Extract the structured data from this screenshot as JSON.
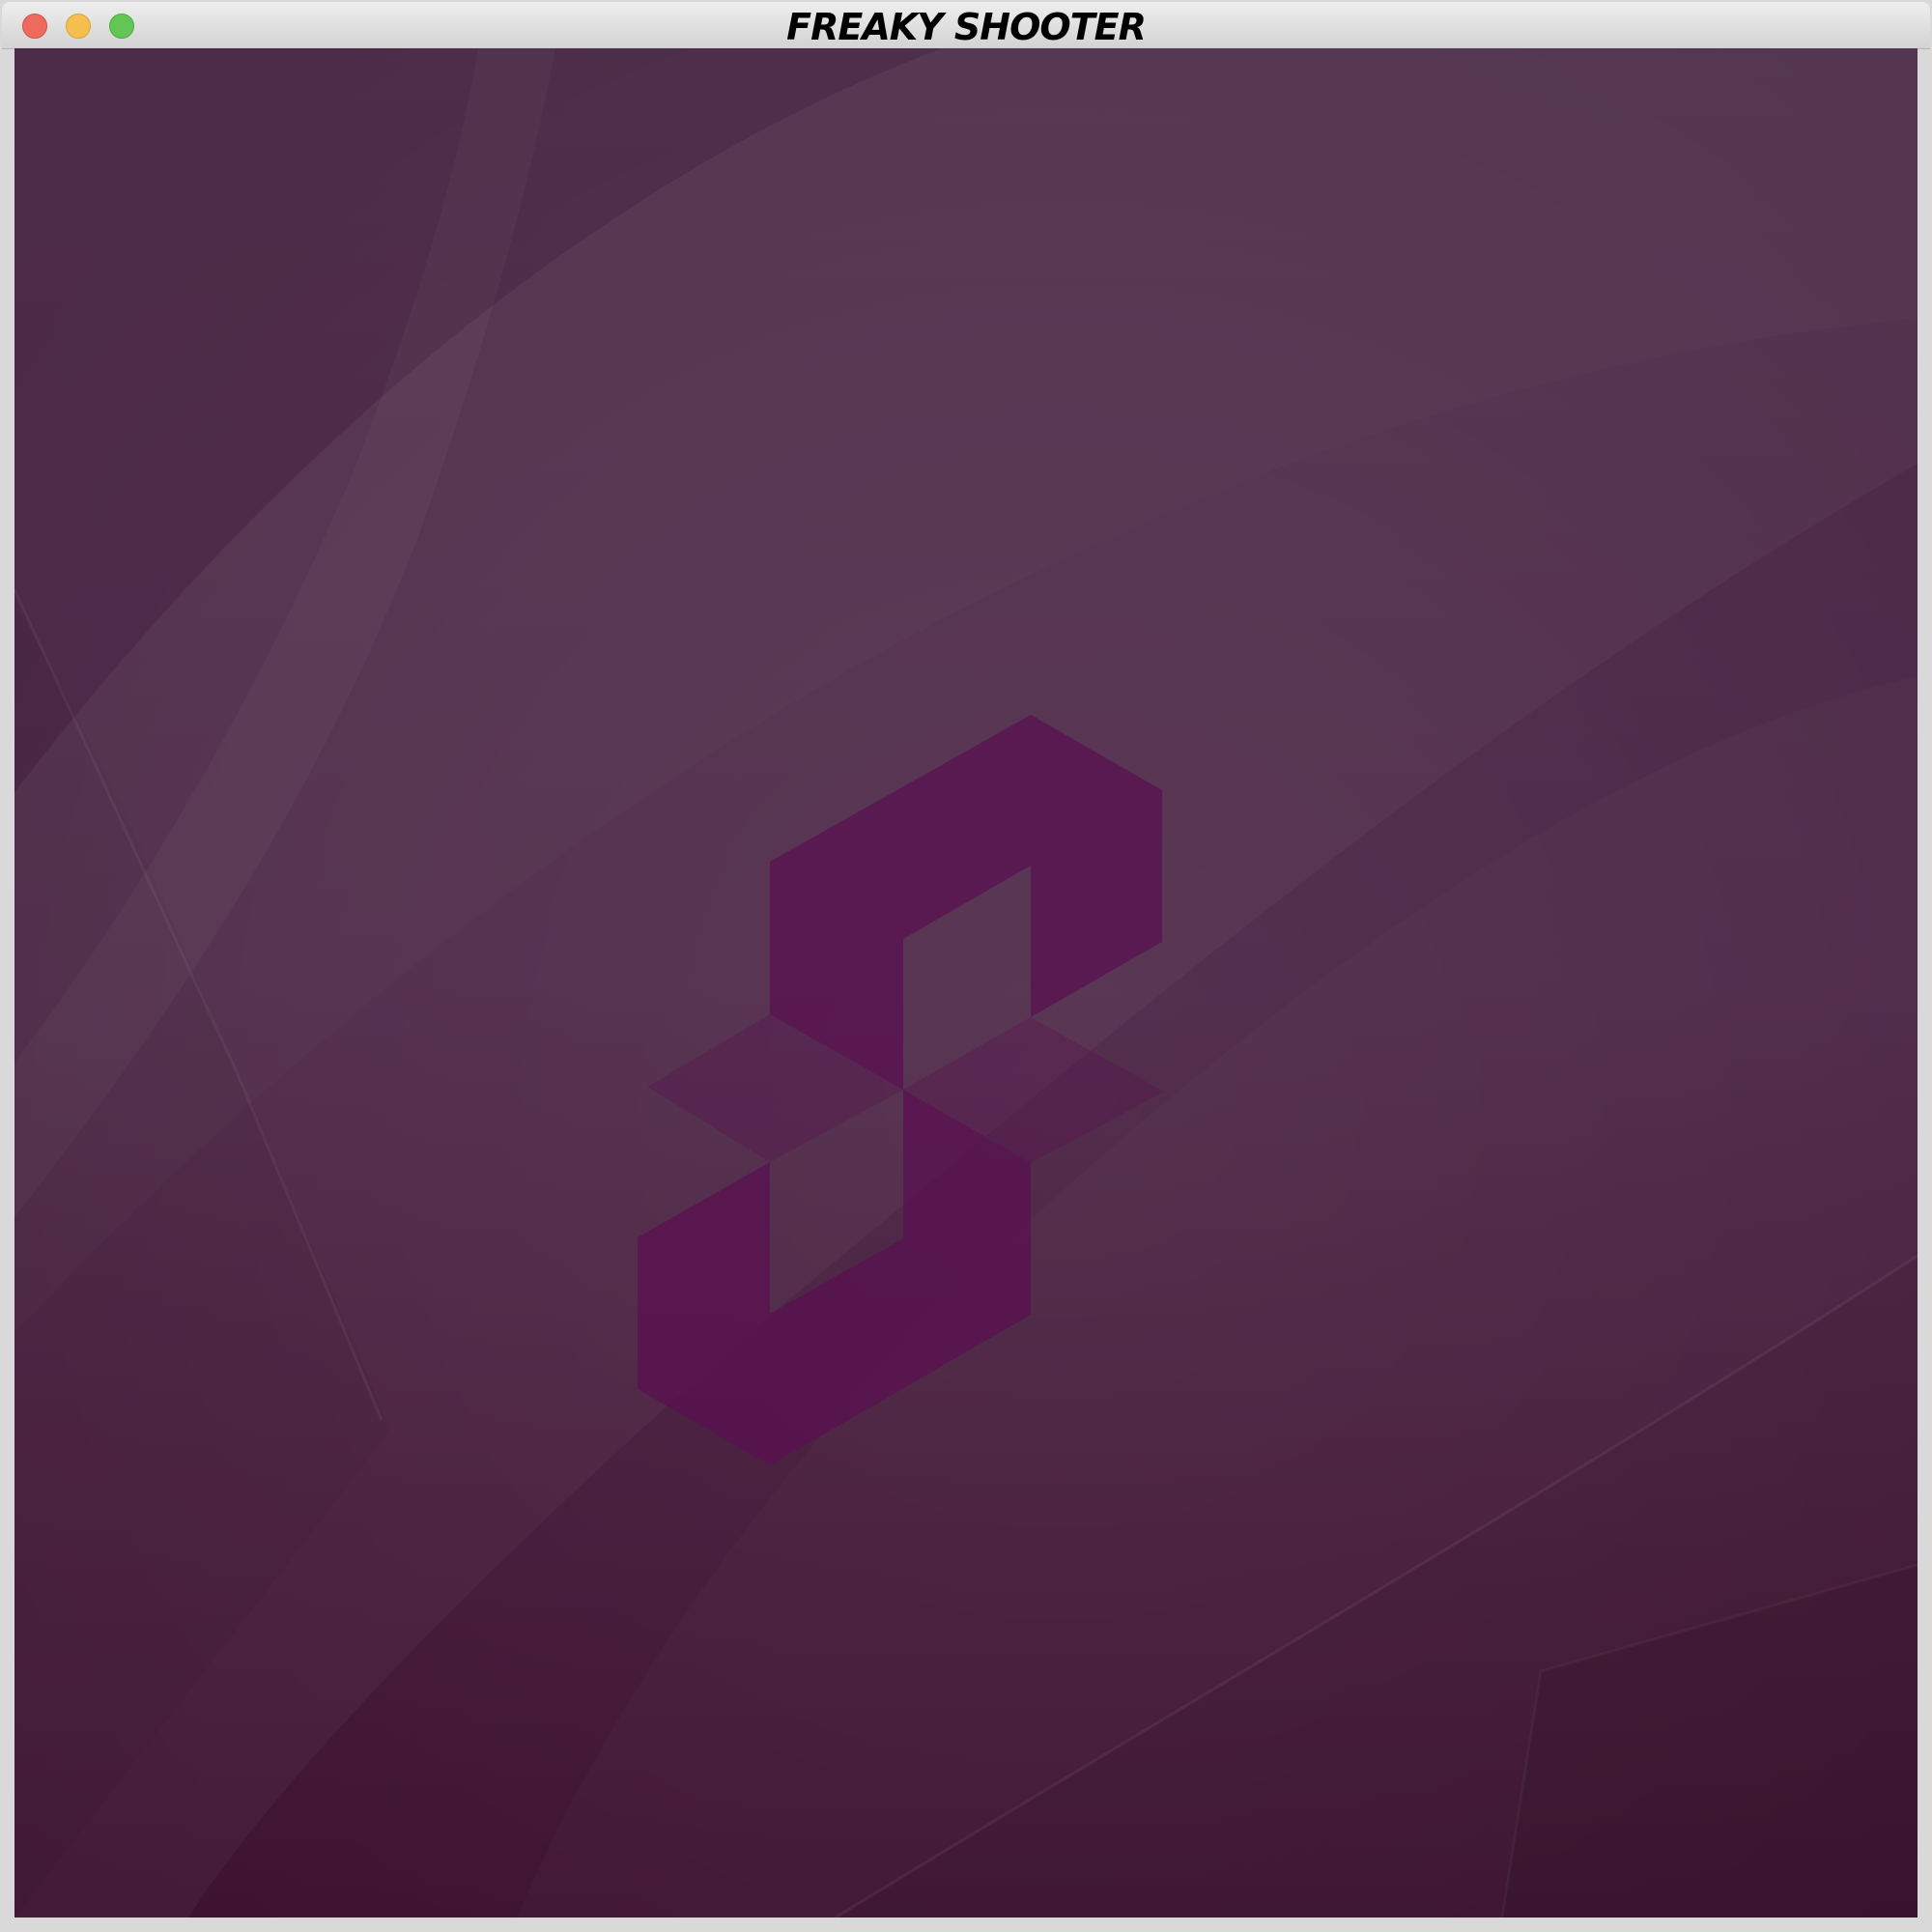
{
  "window": {
    "title": "FREAKY SHOOTER"
  },
  "colors": {
    "background_top": "#4c2c48",
    "background_bottom": "#3d1230",
    "logo_fill": "#5a1050"
  },
  "icons": {
    "close": "close-icon",
    "minimize": "minimize-icon",
    "maximize": "maximize-icon",
    "logo": "s-logo-icon"
  }
}
